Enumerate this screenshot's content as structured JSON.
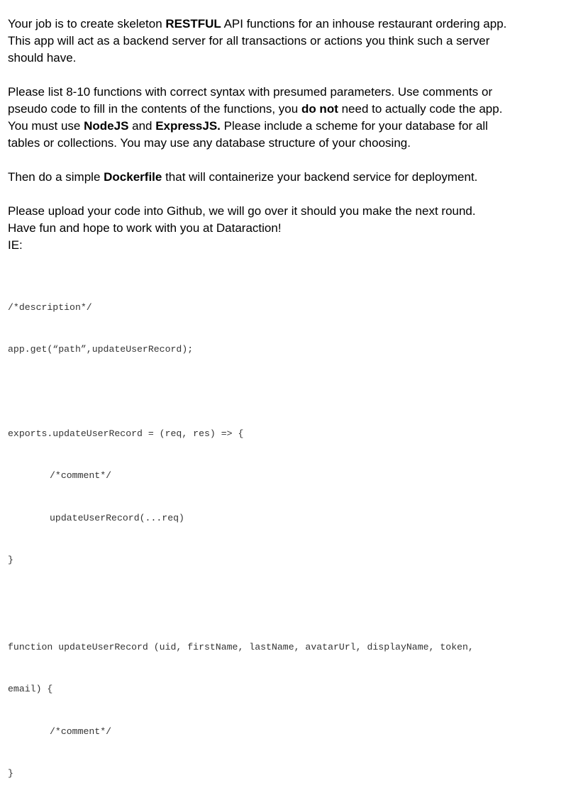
{
  "instructions": {
    "p1": {
      "l1_a": "Your job is to create skeleton ",
      "l1_b": "RESTFUL",
      "l1_c": " API functions for an inhouse restaurant ordering app.",
      "l2": "This app will act as a backend server for all transactions or actions you think such a server",
      "l3": "should have."
    },
    "p2": {
      "l1": "Please list 8-10 functions with correct syntax with presumed parameters. Use comments or",
      "l2_a": "pseudo code to fill in the contents of the functions, you ",
      "l2_b": "do not",
      "l2_c": " need to actually code the app.",
      "l3_a": "You must use ",
      "l3_b": "NodeJS",
      "l3_c": " and ",
      "l3_d": "ExpressJS.",
      "l3_e": " Please include a scheme for your database for all",
      "l4": "tables or collections. You may use any database structure of your choosing."
    },
    "p3": {
      "l1_a": "Then do a simple ",
      "l1_b": "Dockerfile",
      "l1_c": " that will containerize your backend service for deployment."
    },
    "p4": {
      "l1": "Please upload your code into Github, we will go over it should you make the next round.",
      "l2": "Have fun and hope to work with you at Dataraction!",
      "l3": "IE:"
    }
  },
  "code": {
    "c1": "/*description*/",
    "c2": "app.get(“path”,updateUserRecord);",
    "c3": "exports.updateUserRecord = (req, res) => {",
    "c4": "/*comment*/",
    "c5": "updateUserRecord(...req)",
    "c6": "}",
    "c7": "function updateUserRecord (uid, firstName, lastName, avatarUrl, displayName, token,",
    "c8": "email) {",
    "c9": "/*comment*/",
    "c10": "}"
  }
}
